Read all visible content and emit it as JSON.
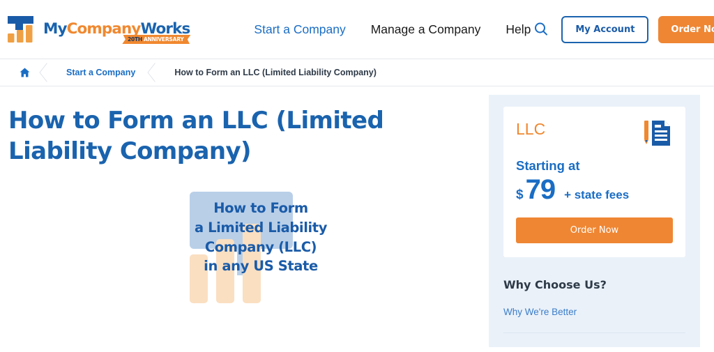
{
  "header": {
    "logo": {
      "mark_icon": "bar-chart-logo-mark",
      "word_my": "My",
      "word_company": "Company",
      "word_works": "Works",
      "ribbon_years": "20TH",
      "ribbon_label": "ANNIVERSARY",
      "colors": {
        "blue": "#1a63ae",
        "orange": "#f0882f"
      }
    },
    "nav": [
      {
        "label": "Start a Company",
        "active": true
      },
      {
        "label": "Manage a Company",
        "active": false
      },
      {
        "label": "Help",
        "active": false
      }
    ],
    "search_icon": "search-icon",
    "account_button": "My Account",
    "order_button": "Order Now"
  },
  "breadcrumb": {
    "home_icon": "home-icon",
    "items": [
      {
        "label": "Start a Company",
        "current": false
      },
      {
        "label": "How to Form an LLC (Limited Liability Company)",
        "current": true
      }
    ]
  },
  "main": {
    "title": "How to Form an LLC (Limited Liability Company)",
    "hero": {
      "line1": "How to Form",
      "line2": "a Limited Liability",
      "line3": "Company (LLC)",
      "line4": "in any US State",
      "shape_blue": "#b9cfe8",
      "shape_orange": "#fadfc1"
    }
  },
  "sidebar": {
    "panel_bg": "#eaf1f9",
    "price_card": {
      "entity_type": "LLC",
      "document_icon": "document-pencil-icon",
      "starting_label": "Starting at",
      "currency": "$",
      "amount": "79",
      "fees_note": "+ state fees",
      "order_button": "Order Now",
      "accent_orange": "#ef8633",
      "accent_blue": "#1a6dc4"
    },
    "why_choose_title": "Why Choose Us?",
    "why_links": [
      {
        "label": "Why We're Better"
      }
    ]
  }
}
